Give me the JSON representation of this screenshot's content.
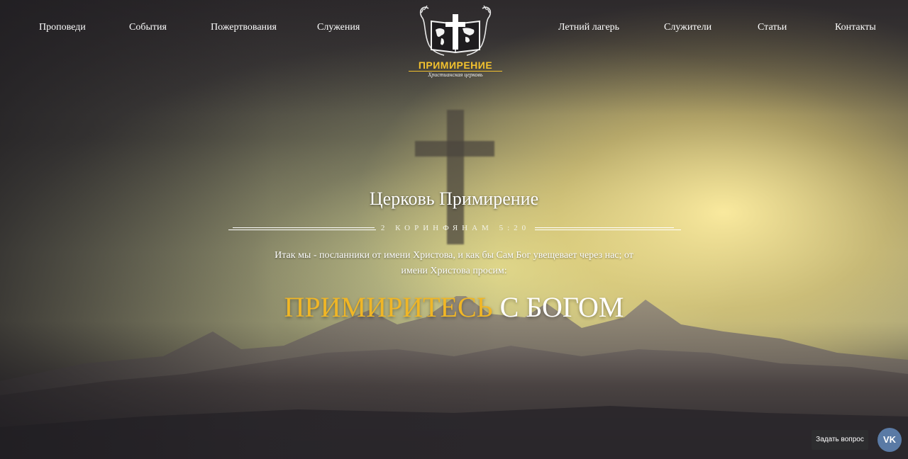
{
  "nav": {
    "left": [
      "Проповеди",
      "События",
      "Пожертвования",
      "Служения"
    ],
    "right": [
      "Летний лагерь",
      "Служители",
      "Статьи",
      "Контакты"
    ]
  },
  "logo": {
    "title": "ПРИМИРЕНИЕ",
    "subtitle": "Христианская церковь"
  },
  "hero": {
    "title": "Церковь Примирение",
    "reference": "2 КОРИНФЯНАМ 5:20",
    "quote": "Итак мы - посланники от имени Христова, и как бы Сам Бог увещевает через нас; от имени Христова просим:",
    "slogan_highlight": "ПРИМИРИТЕСЬ",
    "slogan_rest": "С БОГОМ"
  },
  "widget": {
    "ask_label": "Задать вопрос",
    "vk_label": "VK"
  },
  "colors": {
    "accent": "#f0b626",
    "vk": "#5a7aa5"
  }
}
